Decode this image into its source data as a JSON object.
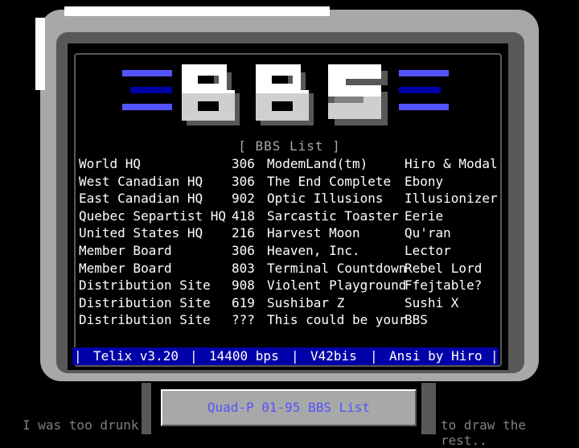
{
  "logo": {
    "text": "BBS"
  },
  "list_title": "[ BBS List ]",
  "bbs_list": [
    {
      "role": "World HQ",
      "area": "306",
      "name": "ModemLand(tm)",
      "sysop": "Hiro & Modal"
    },
    {
      "role": "West Canadian HQ",
      "area": "306",
      "name": "The End Complete",
      "sysop": "Ebony"
    },
    {
      "role": "East Canadian HQ",
      "area": "902",
      "name": "Optic Illusions",
      "sysop": "Illusionizer"
    },
    {
      "role": "Quebec Separtist HQ",
      "area": "418",
      "name": "Sarcastic Toaster",
      "sysop": "Eerie"
    },
    {
      "role": "United States HQ",
      "area": "216",
      "name": "Harvest Moon",
      "sysop": "Qu'ran"
    },
    {
      "role": "Member Board",
      "area": "306",
      "name": "Heaven, Inc.",
      "sysop": "Lector"
    },
    {
      "role": "Member Board",
      "area": "803",
      "name": "Terminal Countdown",
      "sysop": "Rebel Lord"
    },
    {
      "role": "Distribution Site",
      "area": "908",
      "name": "Violent Playground",
      "sysop": "Ffejtable?"
    },
    {
      "role": "Distribution Site",
      "area": "619",
      "name": "Sushibar Z",
      "sysop": "Sushi X"
    },
    {
      "role": "Distribution Site",
      "area": "???",
      "name": "This could be your",
      "sysop": "BBS"
    }
  ],
  "status_bar": {
    "terminal": "Telix v3.20",
    "speed": "14400 bps",
    "protocol": "V42bis",
    "credit": "Ansi by Hiro"
  },
  "plate_text": "Quad-P 01-95 BBS List",
  "footer_left": "I was too drunk",
  "footer_right": "to draw the rest..",
  "colors": {
    "bezel": "#a8a8a8",
    "bezel_dark": "#585858",
    "status_bg": "#0000a8",
    "accent_blue": "#5454fc",
    "text_white": "#ffffff",
    "text_gray": "#a8a8a8"
  }
}
